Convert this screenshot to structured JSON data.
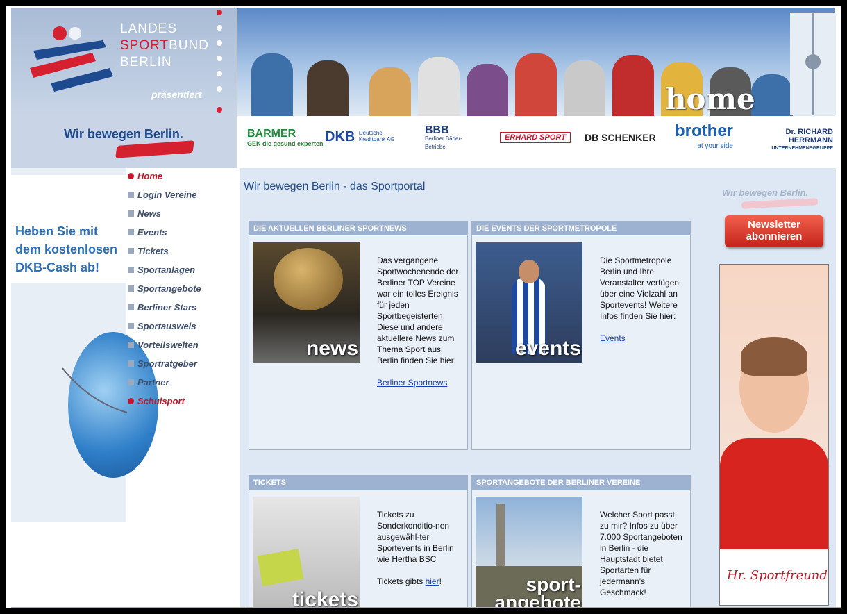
{
  "header": {
    "logo_line1": "LANDES",
    "logo_line2_red": "SPORT",
    "logo_line2_white": "BUND",
    "logo_line3": "BERLIN",
    "praesentiert": "präsentiert",
    "slogan": "Wir bewegen Berlin.",
    "hero_label": "home"
  },
  "sponsors": [
    {
      "name": "BARMER",
      "sub": "GEK die gesund experten",
      "color": "#1f8a3a"
    },
    {
      "name": "DKB",
      "sub": "Deutsche Kreditbank AG",
      "color": "#1d4aa0"
    },
    {
      "name": "BBB",
      "sub": "Berliner Bäder-Betriebe",
      "color": "#1d3a78"
    },
    {
      "name": "ERHARD SPORT",
      "sub": "",
      "color": "#c4152a"
    },
    {
      "name": "DB SCHENKER",
      "sub": "",
      "color": "#222222"
    },
    {
      "name": "brother",
      "sub": "at your side",
      "color": "#1d5fb0"
    },
    {
      "name": "Dr. RICHARD HERRMANN",
      "sub": "UNTERNEHMENSGRUPPE",
      "color": "#1d3a78"
    }
  ],
  "promo": {
    "text": "Heben Sie mit dem kostenlosen DKB-Cash ab!"
  },
  "nav": [
    {
      "label": "Home",
      "active": true
    },
    {
      "label": "Login Vereine"
    },
    {
      "label": "News"
    },
    {
      "label": "Events"
    },
    {
      "label": "Tickets"
    },
    {
      "label": "Sportanlagen"
    },
    {
      "label": "Sportangebote"
    },
    {
      "label": "Berliner Stars"
    },
    {
      "label": "Sportausweis"
    },
    {
      "label": "Vorteilswelten"
    },
    {
      "label": "Sportratgeber"
    },
    {
      "label": "Partner"
    },
    {
      "label": "Schulsport",
      "active": true
    }
  ],
  "main": {
    "title": "Wir bewegen Berlin - das Sportportal",
    "boxes": [
      {
        "heading": "DIE AKTUELLEN BERLINER SPORTNEWS",
        "image_label": "news",
        "text": "Das vergangene Sportwochenende der Berliner TOP Vereine war ein tolles Ereignis für jeden Sportbegeisterten. Diese und andere aktuellere News zum Thema Sport aus Berlin finden Sie hier!",
        "link": "Berliner Sportnews"
      },
      {
        "heading": "DIE EVENTS DER SPORTMETROPOLE",
        "image_label": "events",
        "text": "Die Sportmetropole Berlin und Ihre Veranstalter verfügen über eine Vielzahl an Sportevents! Weitere Infos finden Sie hier:",
        "link": "Events"
      },
      {
        "heading": "TICKETS",
        "image_label": "tickets",
        "text": "Tickets zu Sonderkonditio-nen ausgewähl-ter Sportevents in Berlin wie Hertha BSC",
        "text2": "Tickets gibts ",
        "link": "hier",
        "text3": "!"
      },
      {
        "heading": "SPORTANGEBOTE DER BERLINER VEREINE",
        "image_label_1": "sport-",
        "image_label_2": "angebote",
        "text": "Welcher Sport passt zu mir? Infos zu über 7.000 Sportangeboten in Berlin - die Hauptstadt bietet Sportarten für jedermann's Geschmack!"
      }
    ]
  },
  "right": {
    "slogan": "Wir bewegen Berlin.",
    "newsletter_line1": "Newsletter",
    "newsletter_line2": "abonnieren",
    "ad_signature": "Hr. Sportfreund"
  },
  "colors": {
    "accent_red": "#c4152a",
    "brand_blue": "#1f4c8a",
    "box_header": "#9db1d0"
  }
}
